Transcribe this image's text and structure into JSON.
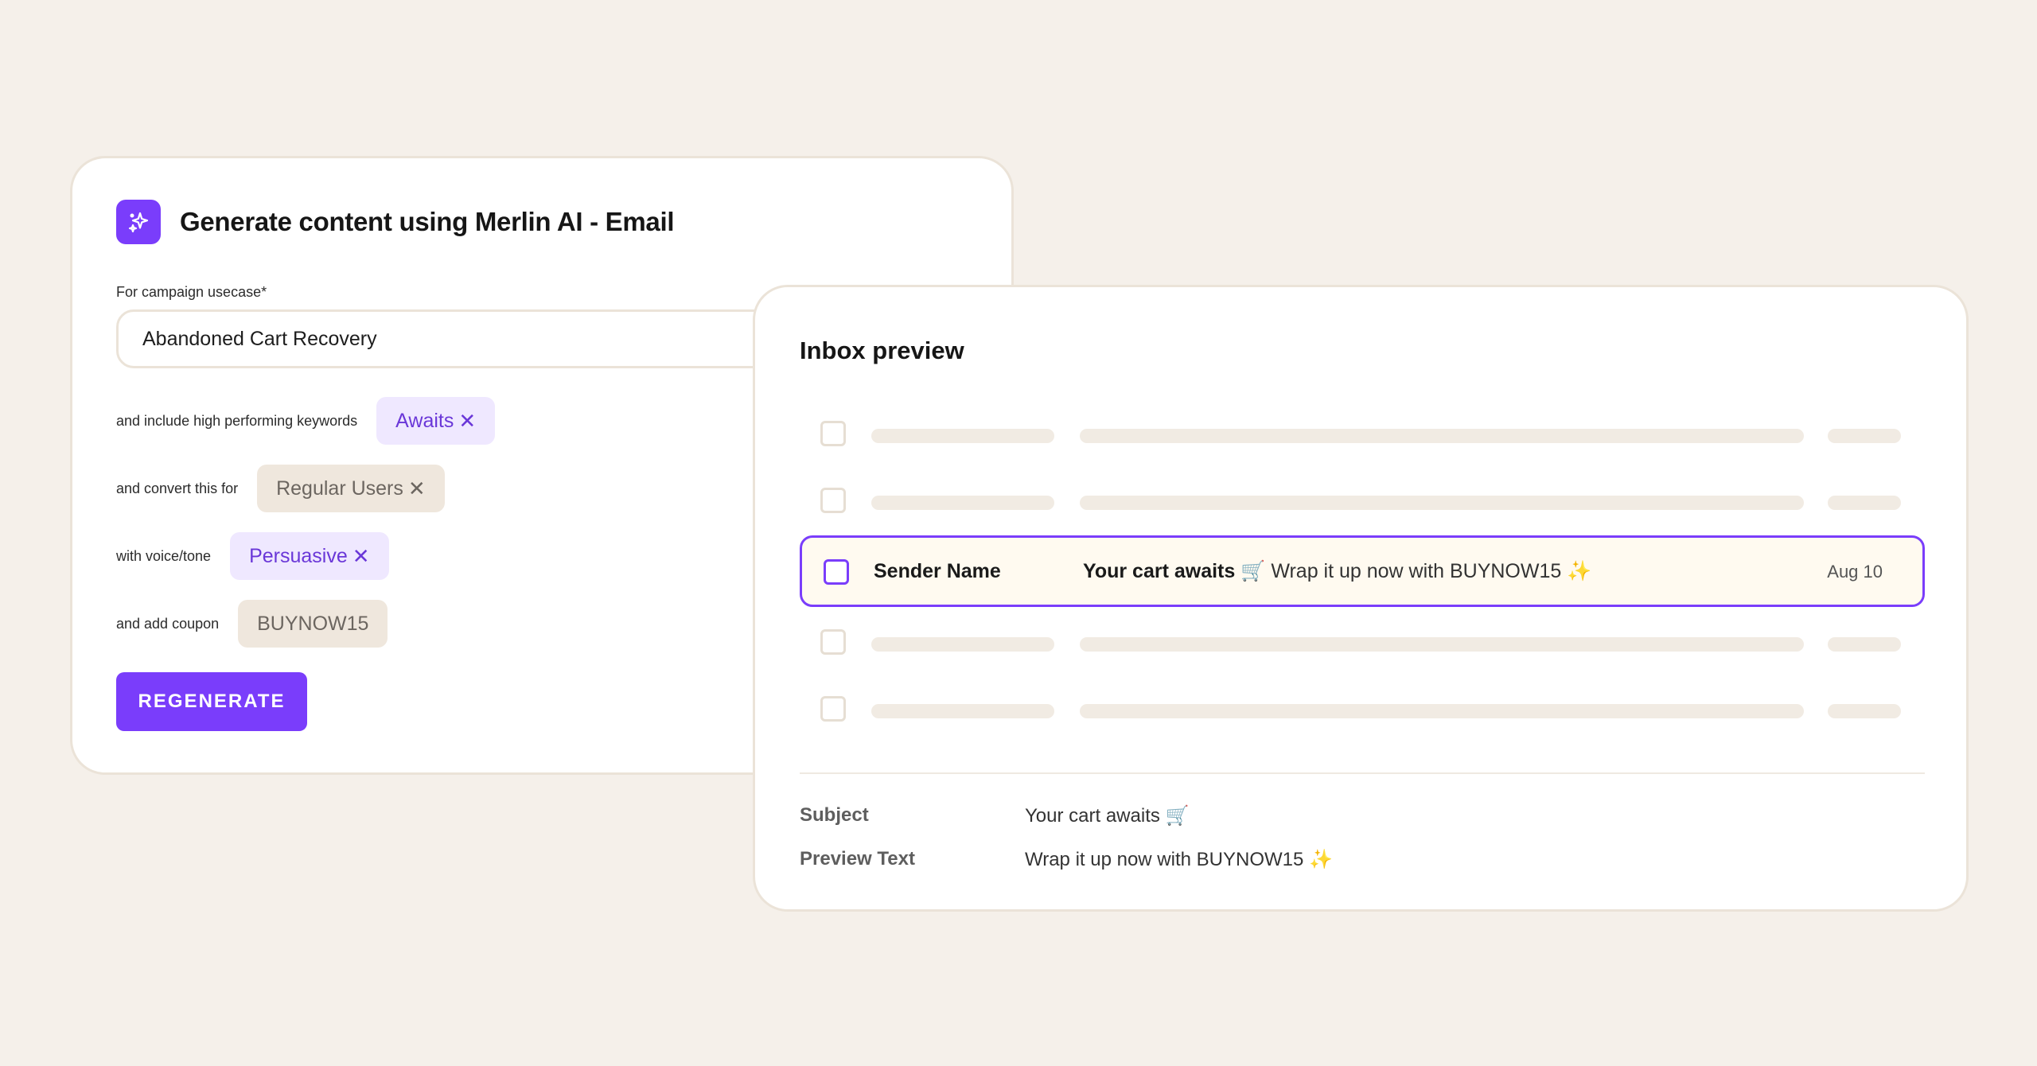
{
  "generator": {
    "title": "Generate content using Merlin AI - Email",
    "logo_icon": "sparkle-icon",
    "usecase_label": "For campaign usecase*",
    "usecase_value": "Abandoned Cart Recovery",
    "keywords": {
      "label": "and include high performing keywords",
      "chip": "Awaits"
    },
    "audience": {
      "label": "and convert this for",
      "chip": "Regular Users"
    },
    "tone": {
      "label": "with voice/tone",
      "chip": "Persuasive"
    },
    "coupon": {
      "label": "and add coupon",
      "chip": "BUYNOW15"
    },
    "remove_glyph": "✕",
    "regenerate_label": "REGENERATE"
  },
  "inbox": {
    "title": "Inbox preview",
    "selected_row": {
      "sender": "Sender Name",
      "subject": "Your cart awaits",
      "cart_emoji": "🛒",
      "preview": "Wrap it up now with BUYNOW15",
      "sparkle_emoji": "✨",
      "date": "Aug 10"
    },
    "details": {
      "subject_label": "Subject",
      "subject_value": "Your cart awaits 🛒",
      "preview_label": "Preview Text",
      "preview_value": "Wrap it up now with BUYNOW15",
      "preview_emoji": "✨"
    }
  },
  "colors": {
    "background": "#f5f0ea",
    "accent": "#7a3dfb",
    "chip_purple_bg": "#efe8ff",
    "chip_beige_bg": "#efe7dd",
    "selected_row_bg": "#fffaf0"
  }
}
